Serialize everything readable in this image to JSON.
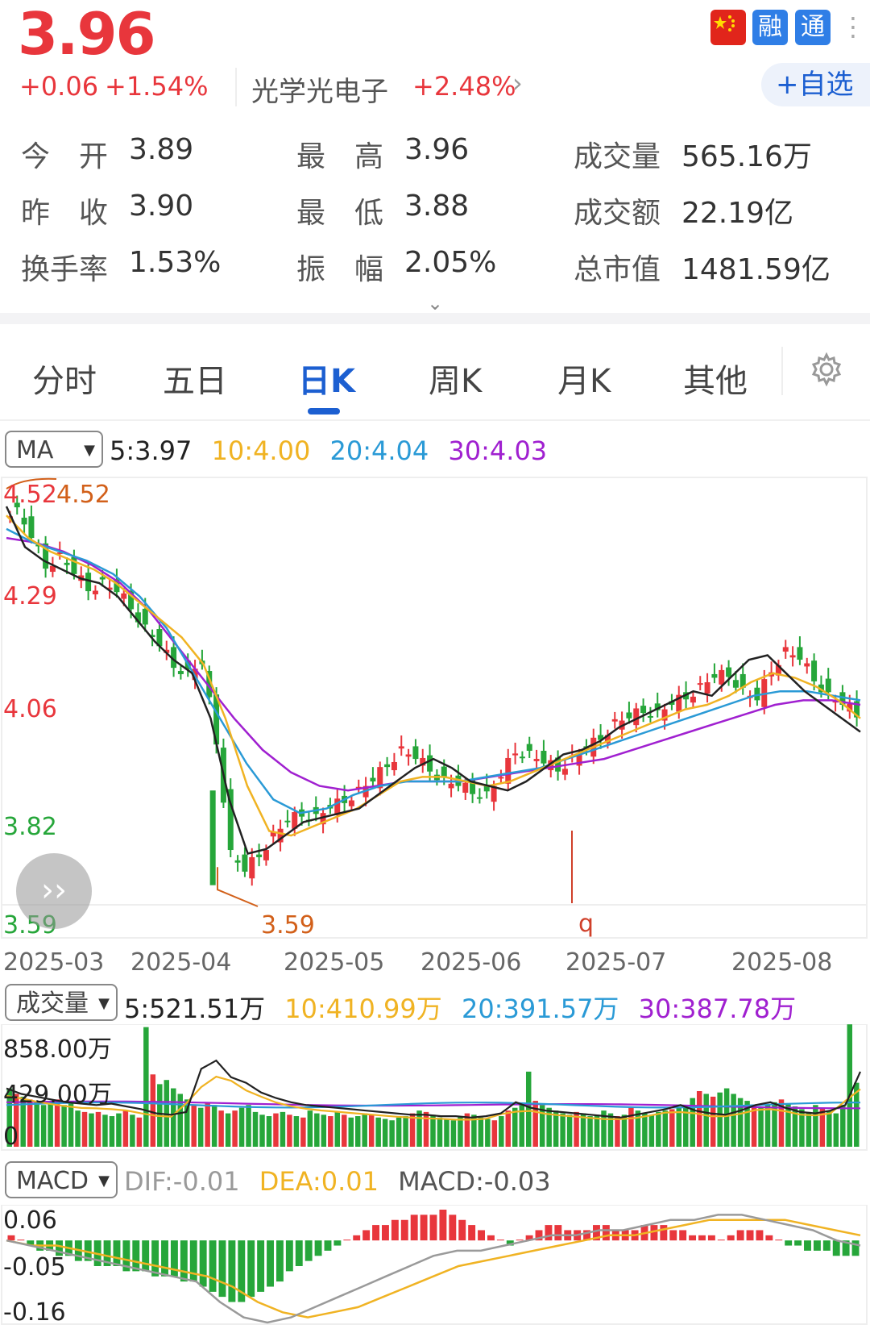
{
  "header": {
    "price": "3.96",
    "change": "+0.06",
    "change_pct": "+1.54%",
    "sector_name": "光学光电子",
    "sector_pct": "+2.48%",
    "sector_arrow": "›",
    "badge_rong": "融",
    "badge_tong": "通",
    "more": "⋮",
    "add_label": "+自选",
    "expand": "⌄"
  },
  "stats": [
    {
      "label": "今　开",
      "value": "3.89"
    },
    {
      "label": "最　高",
      "value": "3.96"
    },
    {
      "label": "成交量",
      "value": "565.16万"
    },
    {
      "label": "昨　收",
      "value": "3.90"
    },
    {
      "label": "最　低",
      "value": "3.88"
    },
    {
      "label": "成交额",
      "value": "22.19亿"
    },
    {
      "label": "换手率",
      "value": "1.53%"
    },
    {
      "label": "振　幅",
      "value": "2.05%"
    },
    {
      "label": "总市值",
      "value": "1481.59亿"
    }
  ],
  "tabs": [
    "分时",
    "五日",
    "日K",
    "周K",
    "月K",
    "其他"
  ],
  "active_tab": 2,
  "ma_selector": "MA",
  "ma_legend": [
    {
      "text": "5:3.97",
      "color": "#222222"
    },
    {
      "text": "10:4.00",
      "color": "#f0b323"
    },
    {
      "text": "20:4.04",
      "color": "#2a9ad6"
    },
    {
      "text": "30:4.03",
      "color": "#a020d0"
    }
  ],
  "price_axis": {
    "top_left": "4.52",
    "top_marker": "4.52",
    "mid_high": "4.29",
    "mid": "4.06",
    "mid_low": "3.82",
    "bottom": "3.59",
    "bottom_marker": "3.59",
    "marker_q": "q"
  },
  "date_axis": [
    "2025-03",
    "2025-04",
    "2025-05",
    "2025-06",
    "2025-07",
    "2025-08"
  ],
  "play_label": "››",
  "vol_selector": "成交量",
  "vol_legend": [
    {
      "text": "5:521.51万",
      "color": "#222222"
    },
    {
      "text": "10:410.99万",
      "color": "#f0b323"
    },
    {
      "text": "20:391.57万",
      "color": "#2a9ad6"
    },
    {
      "text": "30:387.78万",
      "color": "#a020d0"
    }
  ],
  "vol_axis": {
    "top": "858.00万",
    "mid": "429.00万",
    "zero": "0"
  },
  "macd_selector": "MACD",
  "macd_legend": [
    {
      "text": "DIF:-0.01",
      "color": "#9a9a9a"
    },
    {
      "text": "DEA:0.01",
      "color": "#f0b323"
    },
    {
      "text": "MACD:-0.03",
      "color": "#555555"
    }
  ],
  "macd_axis": {
    "top": "0.06",
    "mid": "-0.05",
    "bottom": "-0.16"
  },
  "colors": {
    "up": "#e8363c",
    "down": "#26a63a",
    "accent": "#1c5fd1"
  },
  "chart_data": [
    {
      "type": "candlestick",
      "title": "",
      "xlabel": "",
      "ylabel": "",
      "ylim": [
        3.59,
        4.52
      ],
      "ticks": [
        4.52,
        4.29,
        4.06,
        3.82,
        3.59
      ],
      "high_marker": 4.52,
      "low_marker": 3.59,
      "categories": [
        "2025-03",
        "2025-04",
        "2025-05",
        "2025-06",
        "2025-07",
        "2025-08"
      ],
      "close_path": [
        4.46,
        4.4,
        4.34,
        4.36,
        4.32,
        4.29,
        4.3,
        4.28,
        4.25,
        4.2,
        4.16,
        4.12,
        4.1,
        4.12,
        3.95,
        3.7,
        3.66,
        3.7,
        3.74,
        3.77,
        3.79,
        3.78,
        3.8,
        3.82,
        3.84,
        3.86,
        3.9,
        3.93,
        3.91,
        3.89,
        3.86,
        3.85,
        3.84,
        3.83,
        3.87,
        3.93,
        3.92,
        3.9,
        3.89,
        3.91,
        3.93,
        3.96,
        3.99,
        4.0,
        4.02,
        4.01,
        4.03,
        4.05,
        4.07,
        4.09,
        4.1,
        4.06,
        4.04,
        4.11,
        4.15,
        4.13,
        4.09,
        4.05,
        4.03,
        4.01
      ],
      "ma5": [
        4.47,
        4.38,
        4.35,
        4.33,
        4.31,
        4.3,
        4.27,
        4.22,
        4.17,
        4.13,
        4.1,
        4.0,
        3.82,
        3.7,
        3.71,
        3.74,
        3.77,
        3.78,
        3.79,
        3.8,
        3.83,
        3.86,
        3.89,
        3.91,
        3.89,
        3.86,
        3.85,
        3.84,
        3.86,
        3.89,
        3.92,
        3.93,
        3.95,
        3.98,
        4.0,
        4.02,
        4.04,
        4.06,
        4.05,
        4.09,
        4.13,
        4.14,
        4.1,
        4.06,
        4.03,
        4.0,
        3.97
      ],
      "ma10": [
        4.45,
        4.4,
        4.37,
        4.35,
        4.33,
        4.3,
        4.26,
        4.22,
        4.18,
        4.12,
        4.0,
        3.85,
        3.75,
        3.74,
        3.76,
        3.78,
        3.8,
        3.83,
        3.86,
        3.87,
        3.87,
        3.86,
        3.85,
        3.86,
        3.88,
        3.9,
        3.92,
        3.94,
        3.96,
        3.98,
        4.0,
        4.02,
        4.03,
        4.05,
        4.08,
        4.1,
        4.09,
        4.07,
        4.04,
        4.0
      ],
      "ma20": [
        4.42,
        4.39,
        4.37,
        4.35,
        4.32,
        4.27,
        4.2,
        4.1,
        4.0,
        3.9,
        3.82,
        3.79,
        3.8,
        3.83,
        3.85,
        3.86,
        3.86,
        3.86,
        3.87,
        3.88,
        3.89,
        3.91,
        3.93,
        3.95,
        3.97,
        3.99,
        4.01,
        4.03,
        4.05,
        4.06,
        4.06,
        4.05,
        4.04
      ],
      "ma30": [
        4.4,
        4.39,
        4.37,
        4.34,
        4.3,
        4.24,
        4.16,
        4.08,
        4.0,
        3.93,
        3.88,
        3.85,
        3.84,
        3.85,
        3.86,
        3.86,
        3.86,
        3.87,
        3.88,
        3.89,
        3.9,
        3.91,
        3.93,
        3.95,
        3.97,
        3.99,
        4.01,
        4.03,
        4.04,
        4.04,
        4.03
      ]
    },
    {
      "type": "bar",
      "title": "",
      "ylim": [
        0,
        858
      ],
      "ticks": [
        858,
        429,
        0
      ],
      "values": [
        420,
        380,
        360,
        340,
        330,
        300,
        310,
        340,
        300,
        320,
        260,
        250,
        240,
        250,
        230,
        220,
        240,
        260,
        230,
        210,
        860,
        520,
        450,
        480,
        420,
        380,
        340,
        300,
        280,
        320,
        300,
        260,
        240,
        260,
        280,
        300,
        250,
        230,
        220,
        240,
        250,
        230,
        220,
        210,
        260,
        240,
        230,
        220,
        250,
        230,
        210,
        220,
        240,
        230,
        210,
        200,
        190,
        210,
        220,
        240,
        260,
        250,
        230,
        210,
        200,
        190,
        220,
        240,
        230,
        210,
        200,
        190,
        220,
        260,
        280,
        300,
        540,
        330,
        300,
        280,
        260,
        240,
        230,
        250,
        240,
        220,
        230,
        260,
        240,
        220,
        230,
        280,
        260,
        240,
        230,
        250,
        260,
        270,
        280,
        300,
        350,
        400,
        380,
        360,
        390,
        420,
        380,
        350,
        330,
        300,
        280,
        300,
        320,
        340,
        310,
        290,
        270,
        250,
        300,
        280,
        260,
        240,
        300,
        880,
        460
      ],
      "ma5_path": [
        420,
        380,
        360,
        340,
        320,
        310,
        300,
        310,
        290,
        270,
        240,
        230,
        250,
        560,
        620,
        500,
        460,
        390,
        350,
        320,
        300,
        290,
        280,
        270,
        260,
        250,
        240,
        230,
        230,
        220,
        220,
        210,
        220,
        240,
        320,
        280,
        260,
        250,
        240,
        230,
        220,
        210,
        230,
        250,
        270,
        300,
        260,
        240,
        230,
        260,
        300,
        320,
        280,
        250,
        240,
        260,
        300,
        540
      ]
    },
    {
      "type": "macd",
      "title": "",
      "ylim": [
        -0.16,
        0.06
      ],
      "ticks": [
        0.06,
        -0.05,
        -0.16
      ],
      "histogram": [
        0.01,
        0.0,
        -0.01,
        -0.02,
        -0.02,
        -0.03,
        -0.03,
        -0.04,
        -0.04,
        -0.05,
        -0.05,
        -0.05,
        -0.06,
        -0.06,
        -0.06,
        -0.07,
        -0.07,
        -0.07,
        -0.08,
        -0.08,
        -0.09,
        -0.1,
        -0.11,
        -0.12,
        -0.12,
        -0.11,
        -0.1,
        -0.09,
        -0.08,
        -0.06,
        -0.05,
        -0.04,
        -0.03,
        -0.02,
        -0.01,
        0.0,
        0.01,
        0.02,
        0.03,
        0.03,
        0.04,
        0.04,
        0.05,
        0.05,
        0.05,
        0.06,
        0.05,
        0.04,
        0.03,
        0.02,
        0.01,
        0.0,
        -0.01,
        0.0,
        0.01,
        0.02,
        0.03,
        0.03,
        0.02,
        0.02,
        0.02,
        0.03,
        0.03,
        0.02,
        0.02,
        0.02,
        0.03,
        0.03,
        0.03,
        0.02,
        0.02,
        0.01,
        0.01,
        0.01,
        0.0,
        0.01,
        0.02,
        0.02,
        0.02,
        0.01,
        0.0,
        -0.01,
        -0.01,
        -0.02,
        -0.02,
        -0.02,
        -0.03,
        -0.03,
        -0.03
      ],
      "dif": [
        0.0,
        -0.01,
        -0.02,
        -0.03,
        -0.04,
        -0.05,
        -0.06,
        -0.07,
        -0.08,
        -0.12,
        -0.15,
        -0.16,
        -0.15,
        -0.13,
        -0.11,
        -0.09,
        -0.07,
        -0.05,
        -0.03,
        -0.02,
        -0.02,
        -0.01,
        0.0,
        0.01,
        0.01,
        0.02,
        0.02,
        0.03,
        0.04,
        0.04,
        0.05,
        0.05,
        0.04,
        0.03,
        0.02,
        0.0,
        -0.01
      ],
      "dea": [
        0.0,
        -0.01,
        -0.01,
        -0.02,
        -0.03,
        -0.04,
        -0.05,
        -0.06,
        -0.07,
        -0.09,
        -0.12,
        -0.14,
        -0.15,
        -0.14,
        -0.13,
        -0.11,
        -0.09,
        -0.07,
        -0.05,
        -0.04,
        -0.03,
        -0.02,
        -0.01,
        0.0,
        0.01,
        0.01,
        0.02,
        0.03,
        0.04,
        0.04,
        0.04,
        0.04,
        0.03,
        0.02,
        0.01
      ]
    }
  ]
}
